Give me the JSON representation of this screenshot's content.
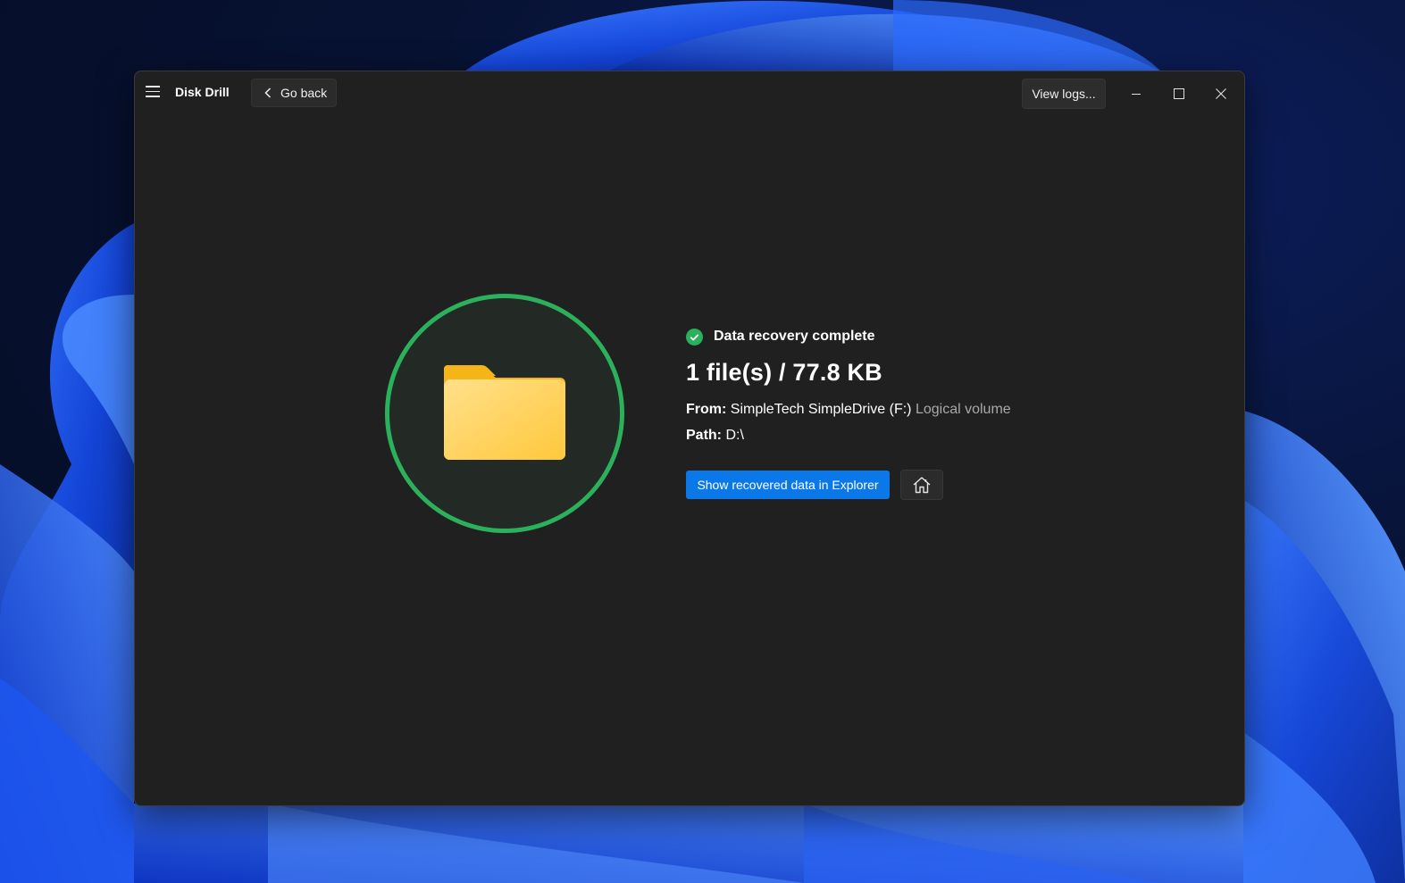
{
  "window": {
    "app_title": "Disk Drill",
    "go_back_label": "Go back",
    "view_logs_label": "View logs..."
  },
  "result": {
    "status": "Data recovery complete",
    "summary": "1 file(s) / 77.8 KB",
    "from_label": "From:",
    "from_value": "SimpleTech SimpleDrive (F:)",
    "from_type": "Logical volume",
    "path_label": "Path:",
    "path_value": "D:\\"
  },
  "actions": {
    "show_in_explorer_label": "Show recovered data in Explorer"
  },
  "icons": {
    "menu": "hamburger-menu-icon",
    "back": "chevron-left-icon",
    "minimize": "minimize-icon",
    "maximize": "maximize-icon",
    "close": "close-icon",
    "folder": "folder-icon",
    "status": "check-circle-icon",
    "home": "home-icon"
  },
  "colors": {
    "accent": "#0a78e8",
    "success": "#2bb15c",
    "folder": "#ffc83d",
    "window_bg": "#202020"
  }
}
